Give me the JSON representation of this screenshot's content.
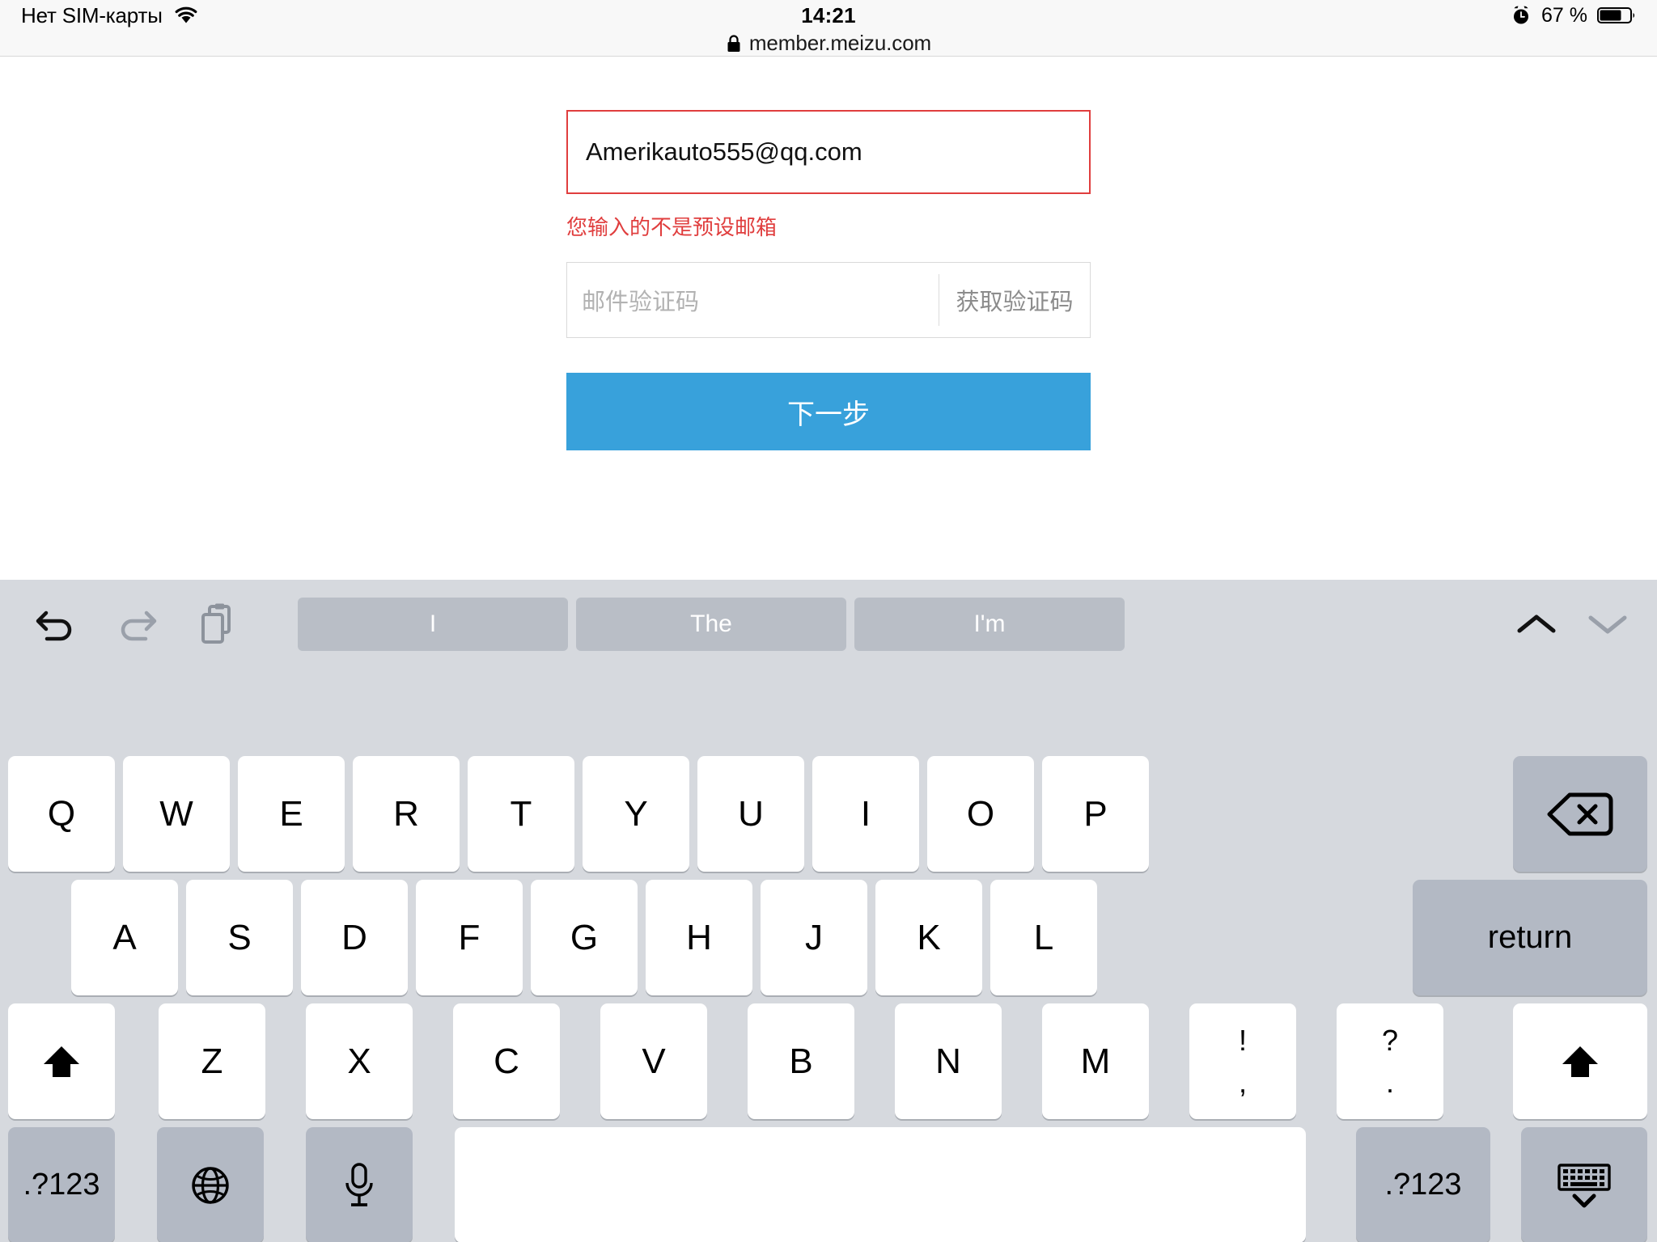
{
  "status_bar": {
    "carrier": "Нет SIM-карты",
    "wifi_icon": "wifi-icon",
    "time": "14:21",
    "alarm_icon": "alarm-clock-icon",
    "battery_percent": "67 %",
    "battery_icon": "battery-icon"
  },
  "url_bar": {
    "lock_icon": "lock-icon",
    "url": "member.meizu.com"
  },
  "form": {
    "email": {
      "value": "Amerikauto555@qq.com",
      "placeholder": "",
      "border_color": "#e03e3e"
    },
    "error_message": "您输入的不是预设邮箱",
    "error_color": "#e03e3e",
    "verification": {
      "placeholder": "邮件验证码",
      "send_code_label": "获取验证码"
    },
    "submit": {
      "label": "下一步",
      "color": "#38a1db"
    }
  },
  "keyboard": {
    "toolbar": {
      "undo_icon": "undo-icon",
      "redo_icon": "redo-icon",
      "paste_icon": "paste-icon",
      "prev_icon": "chevron-up-icon",
      "next_icon": "chevron-down-icon"
    },
    "suggestions": [
      "I",
      "The",
      "I'm"
    ],
    "row1": [
      "Q",
      "W",
      "E",
      "R",
      "T",
      "Y",
      "U",
      "I",
      "O",
      "P"
    ],
    "row1_extra": {
      "backspace_icon": "backspace-icon"
    },
    "row2": [
      "A",
      "S",
      "D",
      "F",
      "G",
      "H",
      "J",
      "K",
      "L"
    ],
    "row2_extra": {
      "return_label": "return"
    },
    "row3": [
      "Z",
      "X",
      "C",
      "V",
      "B",
      "N",
      "M"
    ],
    "row3_extra": {
      "shift_left_icon": "shift-icon",
      "shift_right_icon": "shift-icon",
      "punct1_top": "!",
      "punct1_bottom": ",",
      "punct2_top": "?",
      "punct2_bottom": "."
    },
    "row4": {
      "numeric_left_label": ".?123",
      "globe_icon": "globe-icon",
      "mic_icon": "microphone-icon",
      "space_label": "",
      "numeric_right_label": ".?123",
      "dismiss_icon": "dismiss-keyboard-icon"
    }
  }
}
